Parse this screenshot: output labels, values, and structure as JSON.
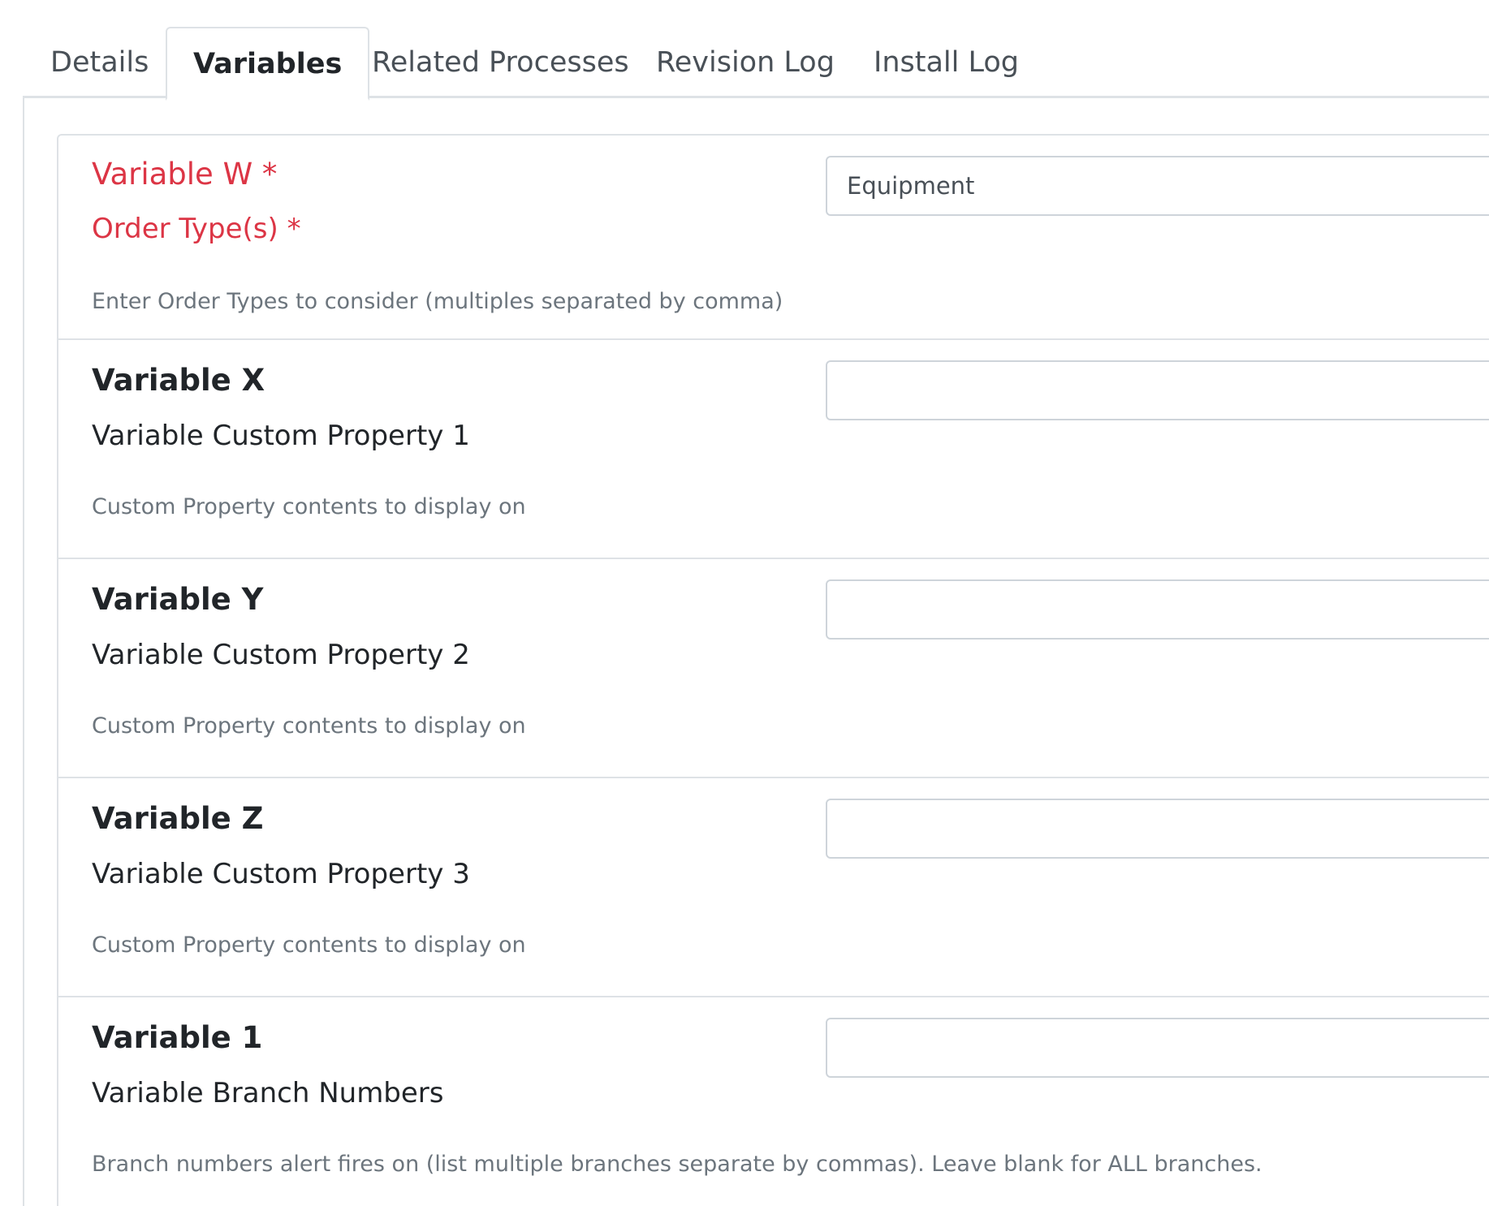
{
  "tabs": [
    {
      "label": "Details",
      "active": false
    },
    {
      "label": "Variables",
      "active": true
    },
    {
      "label": "Related Processes",
      "active": false
    },
    {
      "label": "Revision Log",
      "active": false
    },
    {
      "label": "Install Log",
      "active": false
    }
  ],
  "variables": [
    {
      "name": "Variable W *",
      "title": "Order Type(s) *",
      "help": "Enter Order Types to consider (multiples separated by comma)",
      "value": "Equipment",
      "required": true
    },
    {
      "name": "Variable X",
      "title": "Variable Custom Property 1",
      "help": "Custom Property contents to display on",
      "value": "",
      "required": false
    },
    {
      "name": "Variable Y",
      "title": "Variable Custom Property 2",
      "help": "Custom Property contents to display on",
      "value": "",
      "required": false
    },
    {
      "name": "Variable Z",
      "title": "Variable Custom Property 3",
      "help": "Custom Property contents to display on",
      "value": "",
      "required": false
    },
    {
      "name": "Variable 1",
      "title": "Variable Branch Numbers",
      "help": "Branch numbers alert fires on (list multiple branches separate by commas). Leave blank for ALL branches.",
      "value": "",
      "required": false
    }
  ],
  "colors": {
    "required": "#dc3545",
    "help_text": "#6c757d",
    "border": "#dee2e6"
  }
}
